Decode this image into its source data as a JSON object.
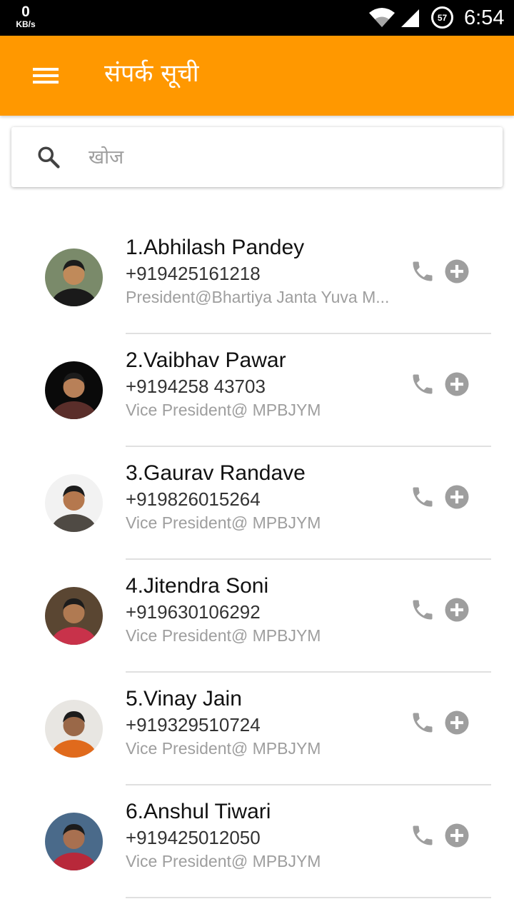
{
  "status_bar": {
    "speed_value": "0",
    "speed_unit": "KB/s",
    "battery_level": "57",
    "time": "6:54"
  },
  "app_bar": {
    "title": "संपर्क सूची",
    "color": "#ff9800"
  },
  "search": {
    "placeholder": "खोज"
  },
  "contacts": [
    {
      "name": "1.Abhilash Pandey",
      "phone": "+919425161218",
      "role": "President@Bhartiya Janta Yuva M...",
      "avatar_palette": [
        "#7a8a6a",
        "#c08a5a",
        "#1a1a1a"
      ]
    },
    {
      "name": "2.Vaibhav Pawar",
      "phone": "+9194258 43703",
      "role": "Vice President@ MPBJYM",
      "avatar_palette": [
        "#0a0a0a",
        "#b88058",
        "#5a2e2a"
      ]
    },
    {
      "name": "3.Gaurav Randave",
      "phone": "+919826015264",
      "role": "Vice President@ MPBJYM",
      "avatar_palette": [
        "#f2f2f2",
        "#b5784e",
        "#4f4a44"
      ]
    },
    {
      "name": "4.Jitendra Soni",
      "phone": "+919630106292",
      "role": "Vice President@ MPBJYM",
      "avatar_palette": [
        "#5a4632",
        "#b07a52",
        "#c8324a"
      ]
    },
    {
      "name": "5.Vinay Jain",
      "phone": "+919329510724",
      "role": "Vice President@ MPBJYM",
      "avatar_palette": [
        "#e8e6e2",
        "#9a6848",
        "#e06a1c"
      ]
    },
    {
      "name": "6.Anshul Tiwari",
      "phone": "+919425012050",
      "role": "Vice President@ MPBJYM",
      "avatar_palette": [
        "#4a6a8a",
        "#a87050",
        "#b8283a"
      ]
    }
  ],
  "icons": {
    "menu": "hamburger-menu-icon",
    "search": "search-icon",
    "call": "phone-icon",
    "add": "add-circle-icon"
  }
}
